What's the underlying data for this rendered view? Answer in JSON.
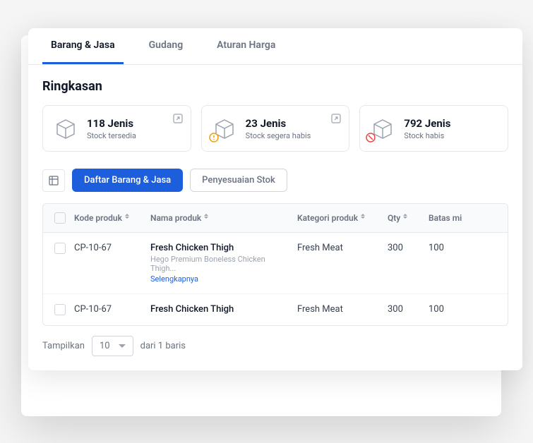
{
  "tabs": {
    "t0": "Barang & Jasa",
    "t1": "Gudang",
    "t2": "Aturan Harga"
  },
  "section_title": "Ringkasan",
  "summary": [
    {
      "count": "118 Jenis",
      "label": "Stock tersedia"
    },
    {
      "count": "23 Jenis",
      "label": "Stock segera habis"
    },
    {
      "count": "792 Jenis",
      "label": "Stock habis"
    }
  ],
  "toolbar": {
    "primary": "Daftar Barang & Jasa",
    "secondary": "Penyesuaian Stok"
  },
  "table": {
    "headers": {
      "code": "Kode produk",
      "name": "Nama produk",
      "category": "Kategori produk",
      "qty": "Qty",
      "min": "Batas mi"
    },
    "rows": [
      {
        "code": "CP-10-67",
        "name": "Fresh Chicken Thigh",
        "sub": "Hego Premium Boneless Chicken Thigh...",
        "more": "Selengkapnya",
        "category": "Fresh Meat",
        "qty": "300",
        "min": "100"
      },
      {
        "code": "CP-10-67",
        "name": "Fresh Chicken Thigh",
        "sub": "",
        "more": "",
        "category": "Fresh Meat",
        "qty": "300",
        "min": "100"
      }
    ]
  },
  "pagination": {
    "show_label": "Tampilkan",
    "per_page": "10",
    "of_label": "dari 1 baris"
  }
}
